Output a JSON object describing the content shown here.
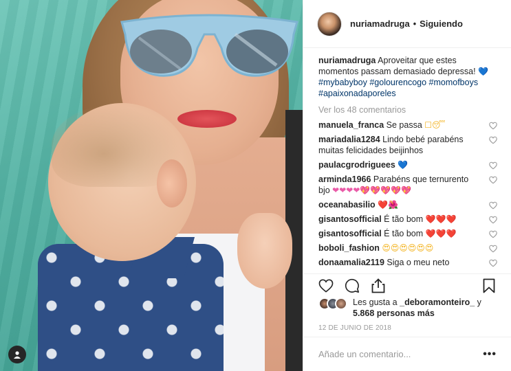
{
  "post": {
    "username": "nuriamadruga",
    "follow_status": "Siguiendo",
    "caption_text": "Aproveitar que estes momentos passam demasiado depressa!",
    "caption_emoji": "💙",
    "hashtags": "#mybabyboy #golourencogo #momofboys #apaixonadaporeles",
    "view_all": "Ver los 48 comentarios"
  },
  "comments": [
    {
      "user": "manuela_franca",
      "text": "Se passa",
      "emoji": "☐😴",
      "emoji_class": "yellow"
    },
    {
      "user": "mariadalia1284",
      "text": "Lindo bebé parabéns muitas felicidades beijinhos",
      "emoji": "",
      "emoji_class": ""
    },
    {
      "user": "paulacgrodriguees",
      "text": "",
      "emoji": "💙",
      "emoji_class": "blue"
    },
    {
      "user": "arminda1966",
      "text": "Parabéns que ternurento bjo",
      "emoji": "❤❤❤❤💖💖💖💖💖",
      "emoji_class": "pink"
    },
    {
      "user": "oceanabasilio",
      "text": "",
      "emoji": "❤️🌺",
      "emoji_class": "red"
    },
    {
      "user": "gisantosofficial",
      "text": "É tão bom",
      "emoji": "❤️❤️❤️",
      "emoji_class": "red"
    },
    {
      "user": "gisantosofficial",
      "text": "É tão bom",
      "emoji": "❤️❤️❤️",
      "emoji_class": "red"
    },
    {
      "user": "boboli_fashion",
      "text": "",
      "emoji": "😍😍😍😍😍😍",
      "emoji_class": "yellow"
    },
    {
      "user": "donaamalia2119",
      "text": "Siga o meu neto",
      "emoji": "",
      "emoji_class": ""
    }
  ],
  "likes": {
    "prefix": "Les gusta a",
    "user": "_deboramonteiro_",
    "conj": "y",
    "count": "5.868 personas más"
  },
  "date": "12 DE JUNIO DE 2018",
  "add_comment_placeholder": "Añade un comentario...",
  "more_label": "•••",
  "icons": [
    "heart-icon",
    "comment-icon",
    "share-icon",
    "bookmark-icon",
    "user-icon"
  ]
}
